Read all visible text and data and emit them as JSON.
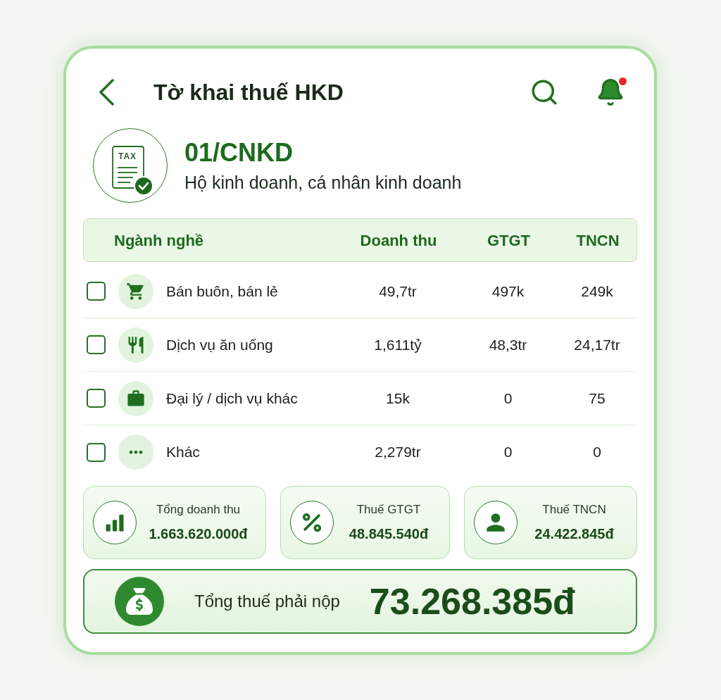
{
  "header": {
    "title": "Tờ khai thuế HKD",
    "unread": true
  },
  "form": {
    "icon_label": "TAX",
    "code": "01/CNKD",
    "description": "Hộ kinh doanh, cá nhân kinh doanh"
  },
  "table": {
    "columns": [
      "Ngành nghề",
      "Doanh thu",
      "GTGT",
      "TNCN"
    ],
    "rows": [
      {
        "kind": "cart",
        "checked": false,
        "name": "Bán buôn, bán lẻ",
        "revenue": "49,7tr",
        "vat": "497k",
        "pit": "249k"
      },
      {
        "kind": "dining",
        "checked": false,
        "name": "Dịch vụ ăn uống",
        "revenue": "1,611tỷ",
        "vat": "48,3tr",
        "pit": "24,17tr"
      },
      {
        "kind": "briefcase",
        "checked": false,
        "name": "Đại lý / dịch vụ khác",
        "revenue": "15k",
        "vat": "0",
        "pit": "75"
      },
      {
        "kind": "more",
        "checked": false,
        "name": "Khác",
        "revenue": "2,279tr",
        "vat": "0",
        "pit": "0"
      }
    ]
  },
  "summary_cards": [
    {
      "kind": "chart",
      "label": "Tổng doanh thu",
      "value": "1.663.620.000đ"
    },
    {
      "kind": "percent",
      "label": "Thuế GTGT",
      "value": "48.845.540đ"
    },
    {
      "kind": "person",
      "label": "Thuế TNCN",
      "value": "24.422.845đ"
    }
  ],
  "total": {
    "label": "Tổng thuế phải nộp",
    "value": "73.268.385đ"
  }
}
